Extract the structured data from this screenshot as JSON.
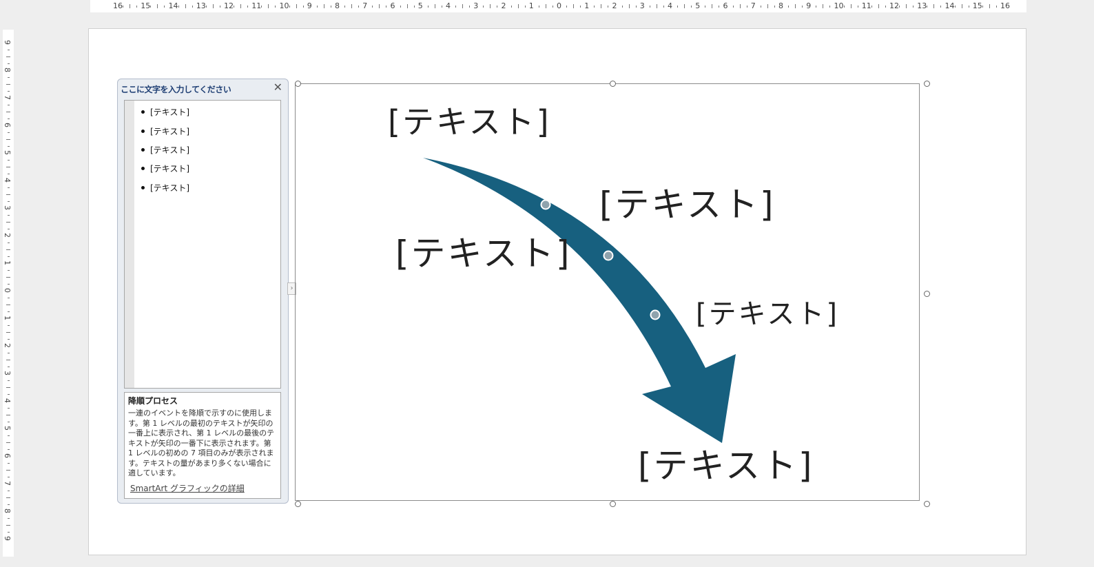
{
  "ruler": {
    "horizontal_labels": [
      "16",
      "15",
      "14",
      "13",
      "12",
      "11",
      "10",
      "9",
      "8",
      "7",
      "6",
      "5",
      "4",
      "3",
      "2",
      "1",
      "0",
      "1",
      "2",
      "3",
      "4",
      "5",
      "6",
      "7",
      "8",
      "9",
      "10",
      "11",
      "12",
      "13",
      "14",
      "15",
      "16"
    ],
    "vertical_labels": [
      "9",
      "8",
      "7",
      "6",
      "5",
      "4",
      "3",
      "2",
      "1",
      "0",
      "1",
      "2",
      "3",
      "4",
      "5",
      "6",
      "7",
      "8",
      "9"
    ]
  },
  "text_pane": {
    "title": "ここに文字を入力してください",
    "close_icon": "close-icon",
    "items": [
      "[テキスト]",
      "[テキスト]",
      "[テキスト]",
      "[テキスト]",
      "[テキスト]"
    ],
    "description_title": "降順プロセス",
    "description_body": "一連のイベントを降順で示すのに使用します。第 1 レベルの最初のテキストが矢印の一番上に表示され、第 1 レベルの最後のテキストが矢印の一番下に表示されます。第 1 レベルの初めの 7 項目のみが表示されます。テキストの量があまり多くない場合に適しています。",
    "link": "SmartArt グラフィックの詳細"
  },
  "smartart": {
    "labels": [
      "[テキスト]",
      "[テキスト]",
      "[テキスト]",
      "[テキスト]",
      "[テキスト]"
    ],
    "arrow_color": "#17607f"
  }
}
